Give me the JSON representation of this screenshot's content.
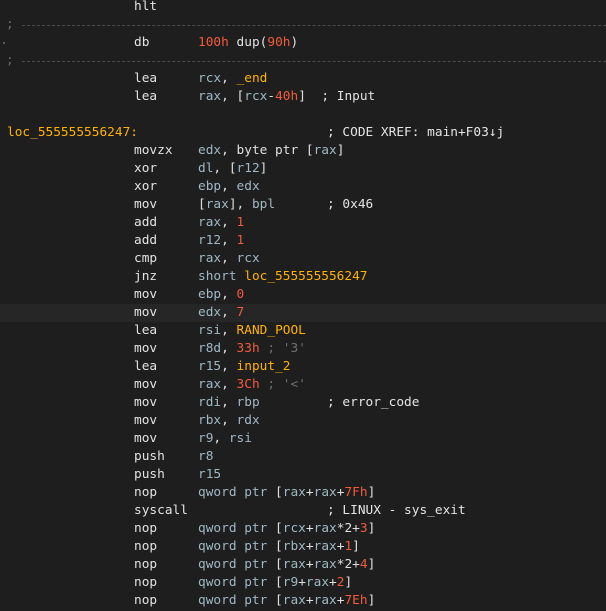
{
  "listing": [
    {
      "type": "ins",
      "mn": "hlt",
      "ops": []
    },
    {
      "type": "sep"
    },
    {
      "type": "ins",
      "mn": "db",
      "ops": [
        {
          "t": "num",
          "v": "100h"
        },
        {
          "t": "plain",
          "v": " dup("
        },
        {
          "t": "num",
          "v": "90h"
        },
        {
          "t": "plain",
          "v": ")"
        }
      ],
      "dot": true
    },
    {
      "type": "sep"
    },
    {
      "type": "ins",
      "mn": "lea",
      "ops": [
        {
          "t": "reg",
          "v": "rcx"
        },
        {
          "t": "plain",
          "v": ", "
        },
        {
          "t": "ref",
          "v": "_end"
        }
      ]
    },
    {
      "type": "ins",
      "mn": "lea",
      "ops": [
        {
          "t": "reg",
          "v": "rax"
        },
        {
          "t": "plain",
          "v": ", ["
        },
        {
          "t": "reg",
          "v": "rcx"
        },
        {
          "t": "plain",
          "v": "-"
        },
        {
          "t": "num",
          "v": "40h"
        },
        {
          "t": "plain",
          "v": "]  ; Input"
        }
      ]
    },
    {
      "type": "blank"
    },
    {
      "type": "label",
      "label": "loc_555555556247:",
      "comment": "; CODE XREF: main+F03↓j"
    },
    {
      "type": "ins",
      "mn": "movzx",
      "ops": [
        {
          "t": "reg",
          "v": "edx"
        },
        {
          "t": "plain",
          "v": ", byte ptr ["
        },
        {
          "t": "reg",
          "v": "rax"
        },
        {
          "t": "plain",
          "v": "]"
        }
      ]
    },
    {
      "type": "ins",
      "mn": "xor",
      "ops": [
        {
          "t": "reg",
          "v": "dl"
        },
        {
          "t": "plain",
          "v": ", ["
        },
        {
          "t": "reg",
          "v": "r12"
        },
        {
          "t": "plain",
          "v": "]"
        }
      ]
    },
    {
      "type": "ins",
      "mn": "xor",
      "ops": [
        {
          "t": "reg",
          "v": "ebp"
        },
        {
          "t": "plain",
          "v": ", "
        },
        {
          "t": "reg",
          "v": "edx"
        }
      ]
    },
    {
      "type": "ins",
      "mn": "mov",
      "ops": [
        {
          "t": "plain",
          "v": "["
        },
        {
          "t": "reg",
          "v": "rax"
        },
        {
          "t": "plain",
          "v": "], "
        },
        {
          "t": "reg",
          "v": "bpl"
        }
      ],
      "comment": "; 0x46"
    },
    {
      "type": "ins",
      "mn": "add",
      "ops": [
        {
          "t": "reg",
          "v": "rax"
        },
        {
          "t": "plain",
          "v": ", "
        },
        {
          "t": "num",
          "v": "1"
        }
      ]
    },
    {
      "type": "ins",
      "mn": "add",
      "ops": [
        {
          "t": "reg",
          "v": "r12"
        },
        {
          "t": "plain",
          "v": ", "
        },
        {
          "t": "num",
          "v": "1"
        }
      ]
    },
    {
      "type": "ins",
      "mn": "cmp",
      "ops": [
        {
          "t": "reg",
          "v": "rax"
        },
        {
          "t": "plain",
          "v": ", "
        },
        {
          "t": "reg",
          "v": "rcx"
        }
      ]
    },
    {
      "type": "ins",
      "mn": "jnz",
      "ops": [
        {
          "t": "kw",
          "v": "short "
        },
        {
          "t": "ref",
          "v": "loc_555555556247"
        }
      ]
    },
    {
      "type": "ins",
      "mn": "mov",
      "ops": [
        {
          "t": "reg",
          "v": "ebp"
        },
        {
          "t": "plain",
          "v": ", "
        },
        {
          "t": "num",
          "v": "0"
        }
      ]
    },
    {
      "type": "ins",
      "mn": "mov",
      "ops": [
        {
          "t": "reg",
          "v": "edx"
        },
        {
          "t": "plain",
          "v": ", "
        },
        {
          "t": "num",
          "v": "7"
        }
      ],
      "highlight": true
    },
    {
      "type": "ins",
      "mn": "lea",
      "ops": [
        {
          "t": "reg",
          "v": "rsi"
        },
        {
          "t": "plain",
          "v": ", "
        },
        {
          "t": "ref",
          "v": "RAND_POOL"
        }
      ]
    },
    {
      "type": "ins",
      "mn": "mov",
      "ops": [
        {
          "t": "reg",
          "v": "r8d"
        },
        {
          "t": "plain",
          "v": ", "
        },
        {
          "t": "num",
          "v": "33h"
        },
        {
          "t": "grey",
          "v": " ; '3'"
        }
      ]
    },
    {
      "type": "ins",
      "mn": "lea",
      "ops": [
        {
          "t": "reg",
          "v": "r15"
        },
        {
          "t": "plain",
          "v": ", "
        },
        {
          "t": "ref",
          "v": "input_2"
        }
      ]
    },
    {
      "type": "ins",
      "mn": "mov",
      "ops": [
        {
          "t": "reg",
          "v": "rax"
        },
        {
          "t": "plain",
          "v": ", "
        },
        {
          "t": "num",
          "v": "3Ch"
        },
        {
          "t": "grey",
          "v": " ; '<'"
        }
      ]
    },
    {
      "type": "ins",
      "mn": "mov",
      "ops": [
        {
          "t": "reg",
          "v": "rdi"
        },
        {
          "t": "plain",
          "v": ", "
        },
        {
          "t": "reg",
          "v": "rbp"
        }
      ],
      "comment": "; error_code"
    },
    {
      "type": "ins",
      "mn": "mov",
      "ops": [
        {
          "t": "reg",
          "v": "rbx"
        },
        {
          "t": "plain",
          "v": ", "
        },
        {
          "t": "reg",
          "v": "rdx"
        }
      ]
    },
    {
      "type": "ins",
      "mn": "mov",
      "ops": [
        {
          "t": "reg",
          "v": "r9"
        },
        {
          "t": "plain",
          "v": ", "
        },
        {
          "t": "reg",
          "v": "rsi"
        }
      ]
    },
    {
      "type": "ins",
      "mn": "push",
      "ops": [
        {
          "t": "reg",
          "v": "r8"
        }
      ]
    },
    {
      "type": "ins",
      "mn": "push",
      "ops": [
        {
          "t": "reg",
          "v": "r15"
        }
      ]
    },
    {
      "type": "ins",
      "mn": "nop",
      "ops": [
        {
          "t": "kw",
          "v": "qword ptr "
        },
        {
          "t": "plain",
          "v": "["
        },
        {
          "t": "reg",
          "v": "rax"
        },
        {
          "t": "plain",
          "v": "+"
        },
        {
          "t": "reg",
          "v": "rax"
        },
        {
          "t": "plain",
          "v": "+"
        },
        {
          "t": "num",
          "v": "7Fh"
        },
        {
          "t": "plain",
          "v": "]"
        }
      ]
    },
    {
      "type": "ins",
      "mn": "syscall",
      "ops": [],
      "comment": "; LINUX - sys_exit"
    },
    {
      "type": "ins",
      "mn": "nop",
      "ops": [
        {
          "t": "kw",
          "v": "qword ptr "
        },
        {
          "t": "plain",
          "v": "["
        },
        {
          "t": "reg",
          "v": "rcx"
        },
        {
          "t": "plain",
          "v": "+"
        },
        {
          "t": "reg",
          "v": "rax"
        },
        {
          "t": "plain",
          "v": "*2+"
        },
        {
          "t": "num",
          "v": "3"
        },
        {
          "t": "plain",
          "v": "]"
        }
      ]
    },
    {
      "type": "ins",
      "mn": "nop",
      "ops": [
        {
          "t": "kw",
          "v": "qword ptr "
        },
        {
          "t": "plain",
          "v": "["
        },
        {
          "t": "reg",
          "v": "rbx"
        },
        {
          "t": "plain",
          "v": "+"
        },
        {
          "t": "reg",
          "v": "rax"
        },
        {
          "t": "plain",
          "v": "+"
        },
        {
          "t": "num",
          "v": "1"
        },
        {
          "t": "plain",
          "v": "]"
        }
      ]
    },
    {
      "type": "ins",
      "mn": "nop",
      "ops": [
        {
          "t": "kw",
          "v": "qword ptr "
        },
        {
          "t": "plain",
          "v": "["
        },
        {
          "t": "reg",
          "v": "rax"
        },
        {
          "t": "plain",
          "v": "+"
        },
        {
          "t": "reg",
          "v": "rax"
        },
        {
          "t": "plain",
          "v": "*2+"
        },
        {
          "t": "num",
          "v": "4"
        },
        {
          "t": "plain",
          "v": "]"
        }
      ]
    },
    {
      "type": "ins",
      "mn": "nop",
      "ops": [
        {
          "t": "kw",
          "v": "qword ptr "
        },
        {
          "t": "plain",
          "v": "["
        },
        {
          "t": "reg",
          "v": "r9"
        },
        {
          "t": "plain",
          "v": "+"
        },
        {
          "t": "reg",
          "v": "rax"
        },
        {
          "t": "plain",
          "v": "+"
        },
        {
          "t": "num",
          "v": "2"
        },
        {
          "t": "plain",
          "v": "]"
        }
      ]
    },
    {
      "type": "ins",
      "mn": "nop",
      "ops": [
        {
          "t": "kw",
          "v": "qword ptr "
        },
        {
          "t": "plain",
          "v": "["
        },
        {
          "t": "reg",
          "v": "rax"
        },
        {
          "t": "plain",
          "v": "+"
        },
        {
          "t": "reg",
          "v": "rax"
        },
        {
          "t": "plain",
          "v": "+"
        },
        {
          "t": "num",
          "v": "7Eh"
        },
        {
          "t": "plain",
          "v": "]"
        }
      ]
    }
  ]
}
